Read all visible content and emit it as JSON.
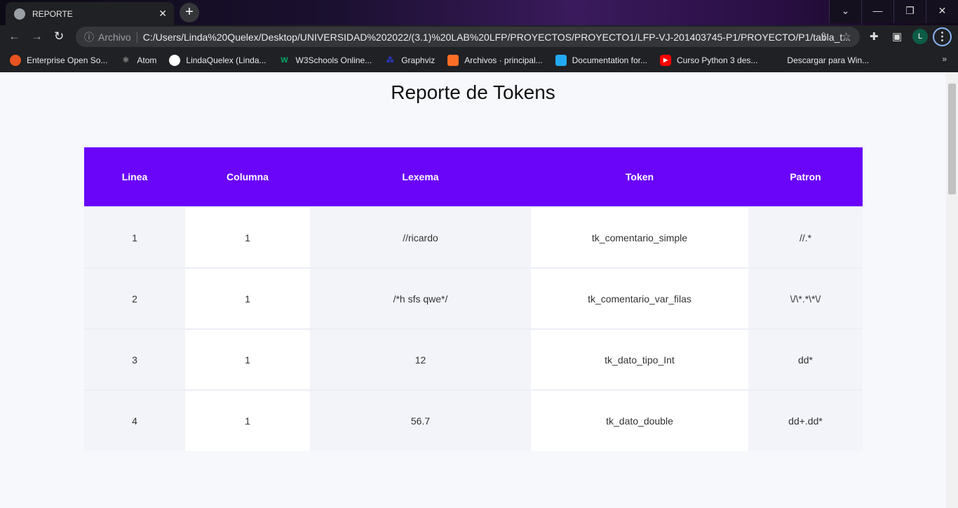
{
  "browser": {
    "tab_title": "REPORTE",
    "address_label": "Archivo",
    "url": "C:/Users/Linda%20Quelex/Desktop/UNIVERSIDAD%202022/(3.1)%20LAB%20LFP/PROYECTOS/PROYECTO1/LFP-VJ-201403745-P1/PROYECTO/P1/tabla_t...",
    "avatar_letter": "L",
    "bookmarks": [
      {
        "label": "Enterprise Open So...",
        "icon": "ubuntu-icon",
        "color": "#e95420"
      },
      {
        "label": "Atom",
        "icon": "atom-icon",
        "color": "#666666"
      },
      {
        "label": "LindaQuelex (Linda...",
        "icon": "github-icon",
        "color": "#ffffff"
      },
      {
        "label": "W3Schools Online...",
        "icon": "w3schools-icon",
        "color": "#04aa6d"
      },
      {
        "label": "Graphviz",
        "icon": "graphviz-icon",
        "color": "#2a3bd6"
      },
      {
        "label": "Archivos · principal...",
        "icon": "gitlab-icon",
        "color": "#fc6d26"
      },
      {
        "label": "Documentation for...",
        "icon": "vscode-icon",
        "color": "#23a9f2"
      },
      {
        "label": "Curso Python 3 des...",
        "icon": "youtube-icon",
        "color": "#ff0000"
      },
      {
        "label": "Descargar para Win...",
        "icon": "blank-icon",
        "color": "#202124"
      }
    ]
  },
  "page": {
    "title": "Reporte de Tokens",
    "header_color": "#6a05fa",
    "columns": [
      "Linea",
      "Columna",
      "Lexema",
      "Token",
      "Patron"
    ],
    "rows": [
      [
        "1",
        "1",
        "//ricardo",
        "tk_comentario_simple",
        "//.*"
      ],
      [
        "2",
        "1",
        "/*h sfs qwe*/",
        "tk_comentario_var_filas",
        "\\/\\*.*\\*\\/"
      ],
      [
        "3",
        "1",
        "12",
        "tk_dato_tipo_Int",
        "dd*"
      ],
      [
        "4",
        "1",
        "56.7",
        "tk_dato_double",
        "dd+.dd*"
      ]
    ]
  }
}
